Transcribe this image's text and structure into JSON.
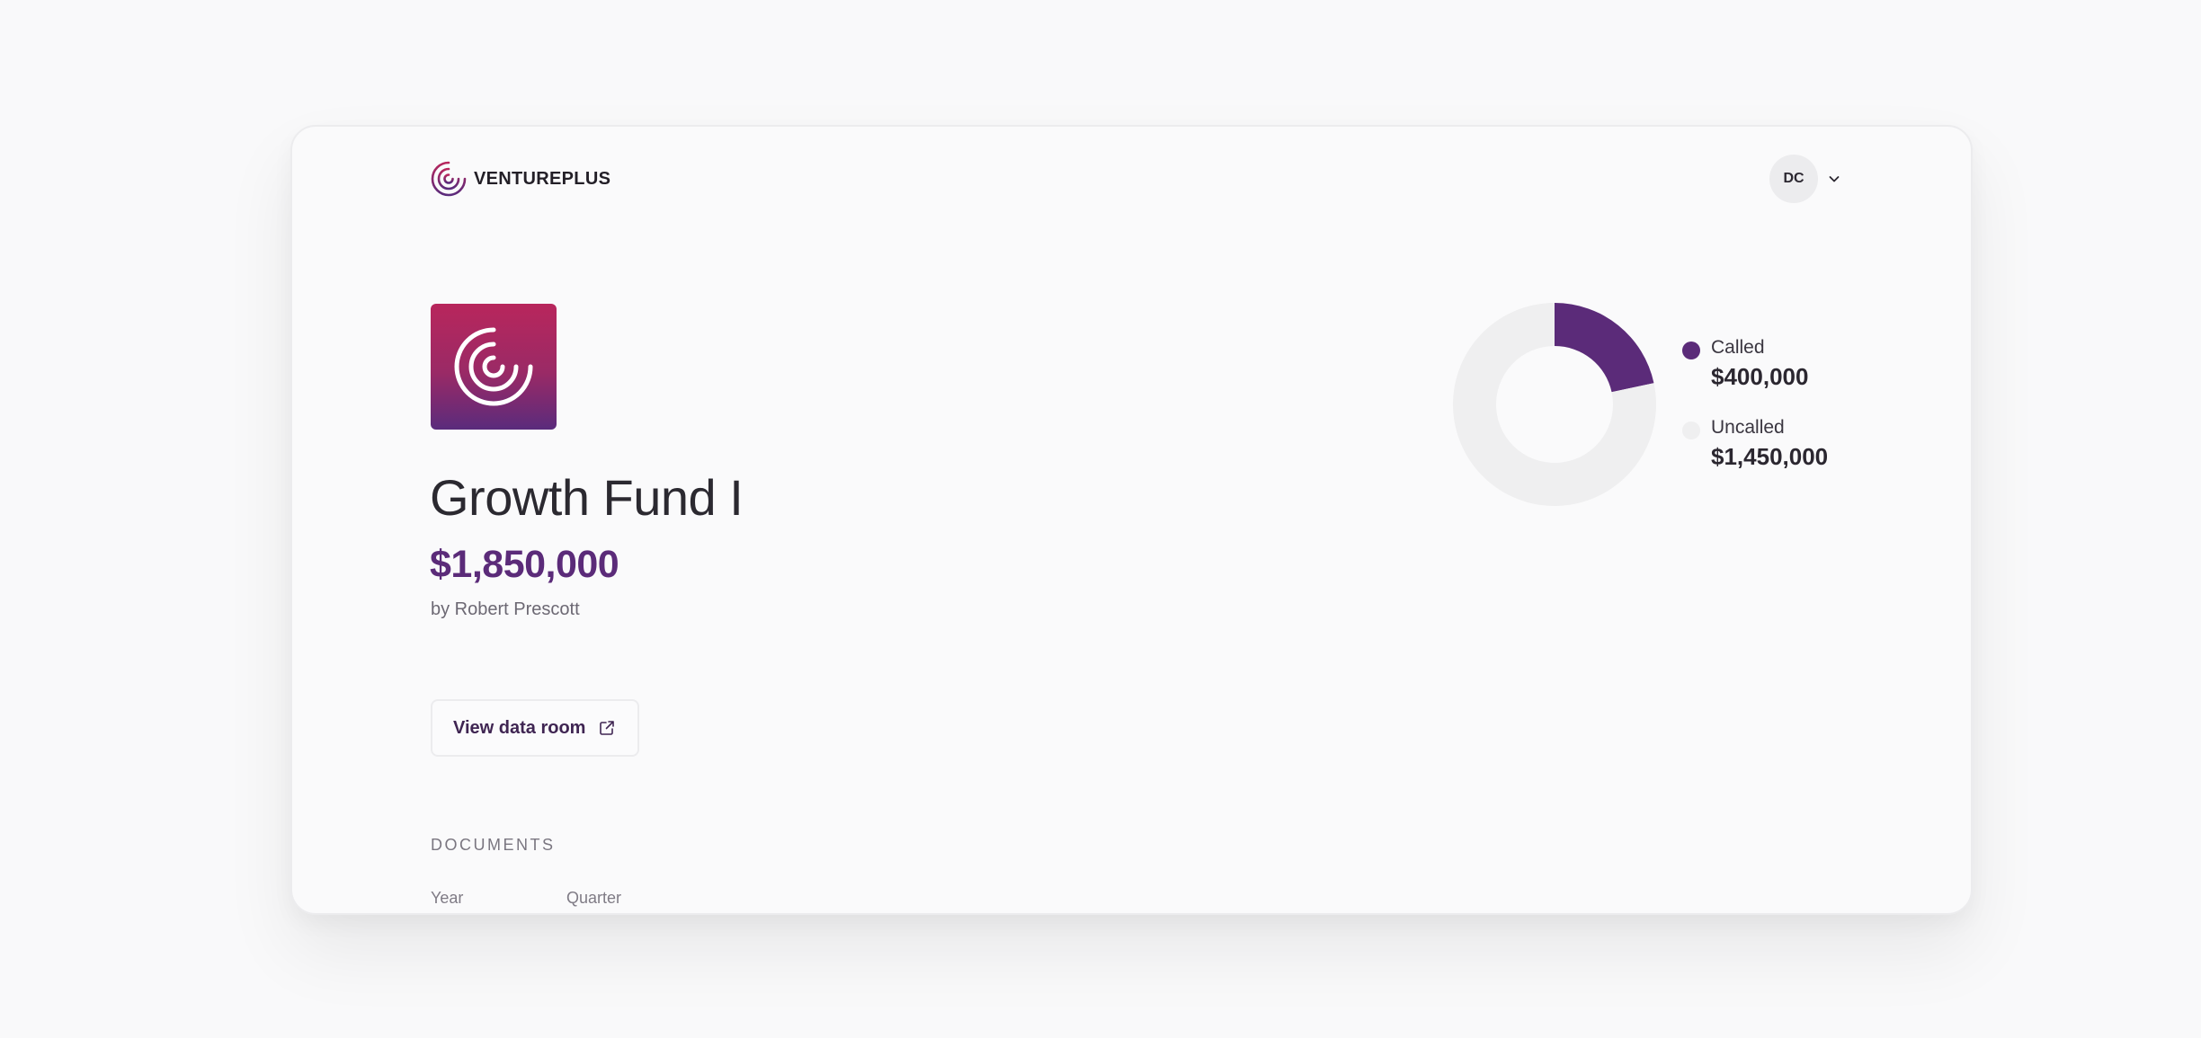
{
  "header": {
    "brand_name": "VENTUREPLUS",
    "user_initials": "DC"
  },
  "fund": {
    "name": "Growth Fund I",
    "total": "$1,850,000",
    "manager": "by Robert Prescott",
    "data_room_label": "View data room"
  },
  "documents": {
    "title": "DOCUMENTS",
    "columns": [
      "Year",
      "Quarter"
    ]
  },
  "colors": {
    "accent": "#5b2b79",
    "uncalled": "#efeff0",
    "logo_gradient_top": "#b8265c",
    "logo_gradient_bottom": "#5a2b7c"
  },
  "chart_data": {
    "type": "pie",
    "series": [
      {
        "name": "Called",
        "label": "$400,000",
        "value": 400000,
        "color": "#5b2b79"
      },
      {
        "name": "Uncalled",
        "label": "$1,450,000",
        "value": 1450000,
        "color": "#efeff0"
      }
    ]
  }
}
